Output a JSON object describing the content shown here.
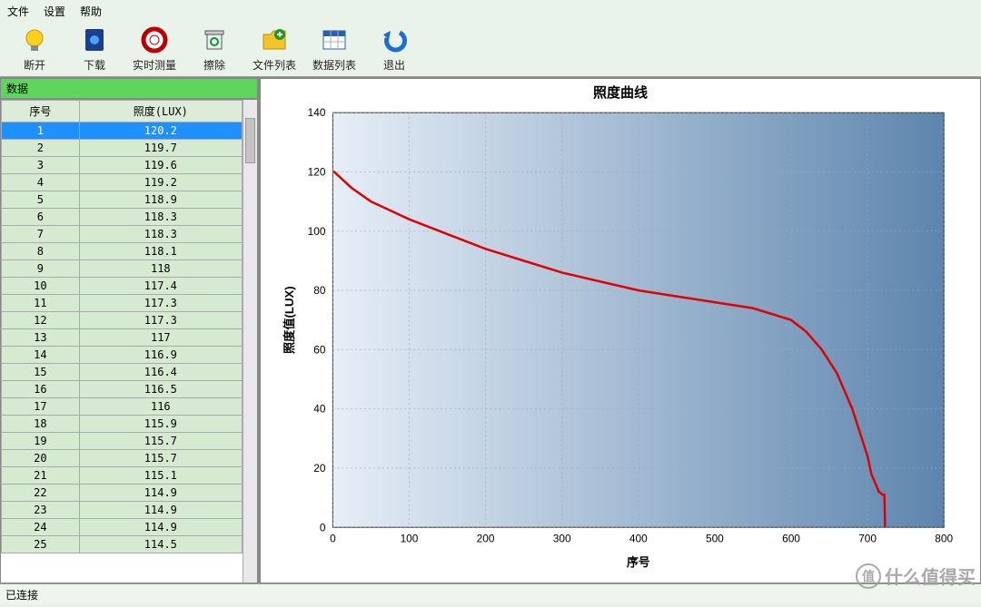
{
  "menu": {
    "file": "文件",
    "settings": "设置",
    "help": "帮助"
  },
  "toolbar": {
    "disconnect": "断开",
    "download": "下载",
    "realtime": "实时测量",
    "clear": "擦除",
    "filelist": "文件列表",
    "datalist": "数据列表",
    "exit": "退出"
  },
  "panel": {
    "title": "数据"
  },
  "table": {
    "col_index": "序号",
    "col_lux": "照度(LUX)",
    "rows": [
      {
        "i": "1",
        "v": "120.2"
      },
      {
        "i": "2",
        "v": "119.7"
      },
      {
        "i": "3",
        "v": "119.6"
      },
      {
        "i": "4",
        "v": "119.2"
      },
      {
        "i": "5",
        "v": "118.9"
      },
      {
        "i": "6",
        "v": "118.3"
      },
      {
        "i": "7",
        "v": "118.3"
      },
      {
        "i": "8",
        "v": "118.1"
      },
      {
        "i": "9",
        "v": "118"
      },
      {
        "i": "10",
        "v": "117.4"
      },
      {
        "i": "11",
        "v": "117.3"
      },
      {
        "i": "12",
        "v": "117.3"
      },
      {
        "i": "13",
        "v": "117"
      },
      {
        "i": "14",
        "v": "116.9"
      },
      {
        "i": "15",
        "v": "116.4"
      },
      {
        "i": "16",
        "v": "116.5"
      },
      {
        "i": "17",
        "v": "116"
      },
      {
        "i": "18",
        "v": "115.9"
      },
      {
        "i": "19",
        "v": "115.7"
      },
      {
        "i": "20",
        "v": "115.7"
      },
      {
        "i": "21",
        "v": "115.1"
      },
      {
        "i": "22",
        "v": "114.9"
      },
      {
        "i": "23",
        "v": "114.9"
      },
      {
        "i": "24",
        "v": "114.9"
      },
      {
        "i": "25",
        "v": "114.5"
      }
    ],
    "selected_index": 0
  },
  "chart": {
    "title": "照度曲线",
    "xlabel": "序号",
    "ylabel": "照度值(LUX)"
  },
  "status": {
    "text": "已连接"
  },
  "watermark": {
    "text": "什么值得买",
    "badge": "值"
  },
  "chart_data": {
    "type": "line",
    "title": "照度曲线",
    "xlabel": "序号",
    "ylabel": "照度值(LUX)",
    "xlim": [
      0,
      800
    ],
    "ylim": [
      0,
      140
    ],
    "xticks": [
      0,
      100,
      200,
      300,
      400,
      500,
      600,
      700,
      800
    ],
    "yticks": [
      0,
      20,
      40,
      60,
      80,
      100,
      120,
      140
    ],
    "series": [
      {
        "name": "LUX",
        "x": [
          1,
          25,
          50,
          75,
          100,
          150,
          200,
          250,
          300,
          350,
          400,
          450,
          500,
          550,
          600,
          620,
          640,
          660,
          670,
          680,
          690,
          700,
          705,
          710,
          715,
          720,
          722,
          723
        ],
        "y": [
          120.2,
          114.5,
          110,
          107,
          104,
          99,
          94,
          90,
          86,
          83,
          80,
          78,
          76,
          74,
          70,
          66,
          60,
          52,
          46,
          40,
          32,
          24,
          18,
          15,
          12,
          11,
          11,
          0
        ]
      }
    ]
  }
}
